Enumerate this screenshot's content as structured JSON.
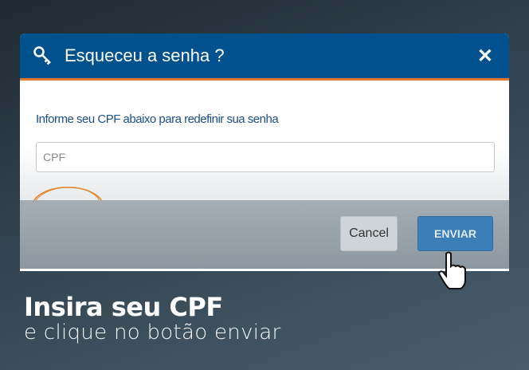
{
  "dialog": {
    "title": "Esqueceu a senha ?",
    "close_label": "✕",
    "instruction": "Informe seu CPF abaixo para redefinir sua senha",
    "cpf_placeholder": "CPF",
    "cpf_value": "",
    "cancel_label": "Cancel",
    "send_label": "ENVIAR"
  },
  "caption": {
    "headline": "Insira seu CPF",
    "subline": "e clique no botão enviar"
  },
  "colors": {
    "header": "#01518f",
    "accent": "#e07a2c",
    "send": "#3a7fb8"
  }
}
